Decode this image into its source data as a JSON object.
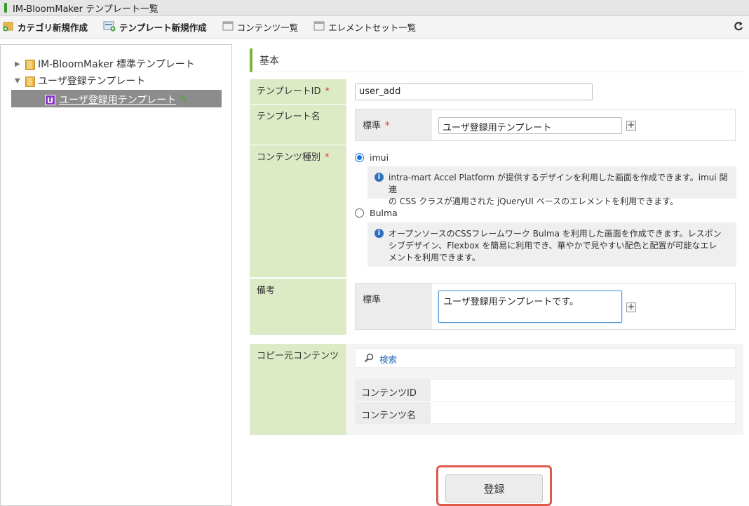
{
  "window": {
    "title": "IM-BloomMaker テンプレート一覧"
  },
  "toolbar": {
    "new_category": "カテゴリ新規作成",
    "new_template": "テンプレート新規作成",
    "content_list": "コンテンツ一覧",
    "element_set_list": "エレメントセット一覧"
  },
  "tree": {
    "items": [
      {
        "label": "IM-BloomMaker 標準テンプレート"
      },
      {
        "label": "ユーザ登録テンプレート"
      },
      {
        "label": "ユーザ登録用テンプレート",
        "badge": "U"
      }
    ]
  },
  "section": {
    "title": "基本"
  },
  "form": {
    "template_id": {
      "label": "テンプレートID",
      "value": "user_add"
    },
    "template_name": {
      "label": "テンプレート名",
      "sublabel": "標準",
      "value": "ユーザ登録用テンプレート"
    },
    "content_type": {
      "label": "コンテンツ種別",
      "options": [
        {
          "label": "imui",
          "selected": true,
          "description": "intra-mart Accel Platform が提供するデザインを利用した画面を作成できます。imui 関連の CSS クラスが適用された jQueryUI ベースのエレメントを利用できます。",
          "desc_line1": "intra-mart Accel Platform が提供するデザインを利用した画面を作成できます。imui 関連",
          "desc_line2": "の CSS クラスが適用された jQueryUI ベースのエレメントを利用できます。"
        },
        {
          "label": "Bulma",
          "selected": false,
          "description": "オープンソースのCSSフレームワーク Bulma を利用した画面を作成できます。レスポンシブデザイン、Flexbox を簡易に利用でき、華やかで見やすい配色と配置が可能なエレメントを利用できます。",
          "desc_line1": "オープンソースのCSSフレームワーク Bulma を利用した画面を作成できます。レスポン",
          "desc_line2": "シブデザイン、Flexbox を簡易に利用でき、華やかで見やすい配色と配置が可能なエレ",
          "desc_line3": "メントを利用できます。"
        }
      ]
    },
    "remarks": {
      "label": "備考",
      "sublabel": "標準",
      "value": "ユーザ登録用テンプレートです。"
    },
    "copy_source": {
      "label": "コピー元コンテンツ",
      "search": "検索",
      "content_id_label": "コンテンツID",
      "content_name_label": "コンテンツ名"
    }
  },
  "actions": {
    "register": "登録"
  },
  "colors": {
    "label_bg": "#dcebc5",
    "accent": "#7cb342",
    "highlight": "#e05a4a"
  }
}
